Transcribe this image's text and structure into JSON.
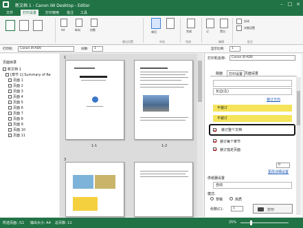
{
  "window": {
    "title": "新文档 1 - Canon iW Desktop - Editor"
  },
  "menu": {
    "file": "文件",
    "print_settings": "打印设置",
    "print_usage": "打印使用",
    "edit": "批注",
    "tools": "工具"
  },
  "ribbon": {
    "groups": {
      "print": "输出设置",
      "layout": "布局",
      "finish": "完成",
      "edit": "编辑",
      "tools": "批注"
    },
    "labels": {
      "paper_size": "A4",
      "orientation": "纵向",
      "copies": "份数",
      "finishing": "完成",
      "staple": "订",
      "color_mode": "黑白",
      "single_doc": "单页",
      "combine": "合并",
      "sort": "排序"
    },
    "print_btn": "自动",
    "right_btns": {
      "b1": "自动",
      "b2": "详细设置"
    }
  },
  "toolbar": {
    "printer_label": "打印机:",
    "printer_value": "Canon iR-ADV",
    "copies_label": "份数:",
    "copies_value": "1",
    "zoom_label": "显示比例:",
    "zoom_value": "1"
  },
  "tree": {
    "header": "页面目录",
    "root": "新文档 1",
    "binder": "[章节 1] Summary of Re",
    "pages": [
      "页面 1",
      "页面 2",
      "页面 3",
      "页面 4",
      "页面 5",
      "页面 6",
      "页面 7",
      "页面 8",
      "页面 9",
      "页面 10",
      "页面 11"
    ]
  },
  "canvas": {
    "sheet1": "1",
    "sheet3": "3",
    "cap1": "1-1",
    "cap2": "1-2"
  },
  "panel": {
    "printer_label": "打印机名称:",
    "printer_value": "Canon iR-ADV",
    "tabs": [
      "版面",
      "打印设置",
      "页面设置"
    ],
    "dd1": "",
    "dd2": "长边(左)",
    "link1": "装订方向",
    "yellow1": "不装订",
    "yellow2": "不装订",
    "opt_selected": "装订整个文档",
    "opt2": "装订每个章节",
    "opt3": "装订指定页面",
    "spin_label": "",
    "spin_value": "0",
    "link2": "更改详细设置",
    "source_label": "供纸器设置",
    "source_value": "自动",
    "print_label": "模式:",
    "radio1": "草稿",
    "radio2": "高质",
    "copies_label": "份数(C):",
    "copies_value": "1",
    "print_btn": "打印"
  },
  "status": {
    "pages": "所选页面: /11",
    "paper": "输出大小: A4",
    "total": "总页数: 11",
    "zoom": "25%"
  },
  "colors": {
    "brand": "#217346",
    "accent_yellow": "#f5e45a"
  }
}
